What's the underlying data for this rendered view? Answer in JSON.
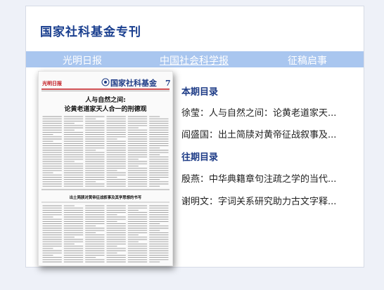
{
  "panel": {
    "title": "国家社科基金专刊",
    "tabs": [
      {
        "label": "光明日报"
      },
      {
        "label": "中国社会科学报"
      },
      {
        "label": "征稿启事"
      }
    ]
  },
  "thumbnail": {
    "masthead": "光明日报",
    "brand": "国家社科基金",
    "page_number": "7",
    "headline_line1": "人与自然之间:",
    "headline_line2": "论黄老道家天人合一的刑德观",
    "second_headline": "出土简牍对黄帝征战叙事及其学思想的书写"
  },
  "current_issue": {
    "heading": "本期目录",
    "articles": [
      {
        "title": "徐莹：人与自然之间：论黄老道家天..."
      },
      {
        "title": "阎盛国：出土简牍对黄帝征战叙事及..."
      }
    ]
  },
  "past_issues": {
    "heading": "往期目录",
    "articles": [
      {
        "title": "殷燕：中华典籍章句注疏之学的当代..."
      },
      {
        "title": "谢明文：字词关系研究助力古文字释..."
      }
    ]
  },
  "colors": {
    "title": "#1a3f8f",
    "tabbar": "#a9c6ef",
    "masthead_red": "#c0151b",
    "background": "#eef1f8"
  }
}
